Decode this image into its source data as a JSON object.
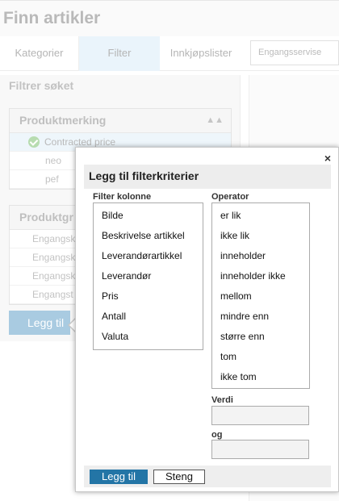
{
  "page": {
    "title": "Finn artikler"
  },
  "tabs": [
    {
      "label": "Kategorier"
    },
    {
      "label": "Filter"
    },
    {
      "label": "Innkjøpslister"
    }
  ],
  "search": {
    "value": "Engangsservise"
  },
  "sidebar": {
    "heading": "Filtrer søket",
    "productmark": {
      "title": "Produktmerking",
      "selected": "Contracted price",
      "items": [
        "neo",
        "pef"
      ]
    },
    "productgroup": {
      "title": "Produktgr",
      "items": [
        "Engangsk",
        "Engangsk",
        "Engangsk",
        "Engangst"
      ]
    },
    "add_button": "Legg til"
  },
  "dialog": {
    "title": "Legg til filterkriterier",
    "close": "×",
    "filter_column_label": "Filter kolonne",
    "filter_columns": [
      "Bilde",
      "Beskrivelse artikkel",
      "Leverandørartikkel",
      "Leverandør",
      "Pris",
      "Antall",
      "Valuta"
    ],
    "operator_label": "Operator",
    "operators": [
      "er lik",
      "ikke lik",
      "inneholder",
      "inneholder ikke",
      "mellom",
      "mindre enn",
      "større enn",
      "tom",
      "ikke tom"
    ],
    "value_label": "Verdi",
    "and_label": "og",
    "add_button": "Legg til",
    "close_button": "Steng"
  }
}
